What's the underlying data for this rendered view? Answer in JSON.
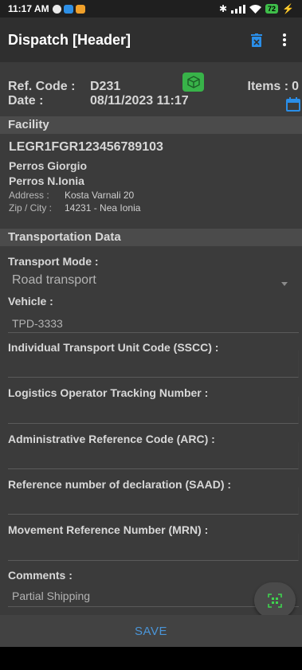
{
  "status": {
    "time": "11:17 AM",
    "battery": "72"
  },
  "app_bar": {
    "title": "Dispatch [Header]"
  },
  "header": {
    "ref_label": "Ref. Code :",
    "ref_value": "D231",
    "items_label": "Items :",
    "items_value": "0",
    "date_label": "Date :",
    "date_value": "08/11/2023 11:17"
  },
  "facility": {
    "section_title": "Facility",
    "code": "LEGR1FGR123456789103",
    "name1": "Perros Giorgio",
    "name2": "Perros N.Ionia",
    "address_label": "Address :",
    "address_value": "Kosta Varnali 20",
    "zip_label": "Zip / City :",
    "zip_value": "14231 - Nea Ionia"
  },
  "transport": {
    "section_title": "Transportation Data",
    "mode_label": "Transport Mode :",
    "mode_value": "Road transport",
    "vehicle_label": "Vehicle :",
    "vehicle_value": "TPD-3333",
    "sscc_label": "Individual Transport Unit Code (SSCC) :",
    "logistics_label": "Logistics Operator Tracking Number :",
    "arc_label": "Administrative Reference Code (ARC) :",
    "saad_label": "Reference number of declaration (SAAD) :",
    "mrn_label": "Movement Reference Number (MRN) :",
    "comments_label": "Comments :",
    "comments_value": "Partial Shipping"
  },
  "footer": {
    "save_label": "SAVE"
  },
  "colors": {
    "accent": "#4a95d8",
    "green": "#38b349",
    "trash_blue": "#2a8ee8"
  }
}
